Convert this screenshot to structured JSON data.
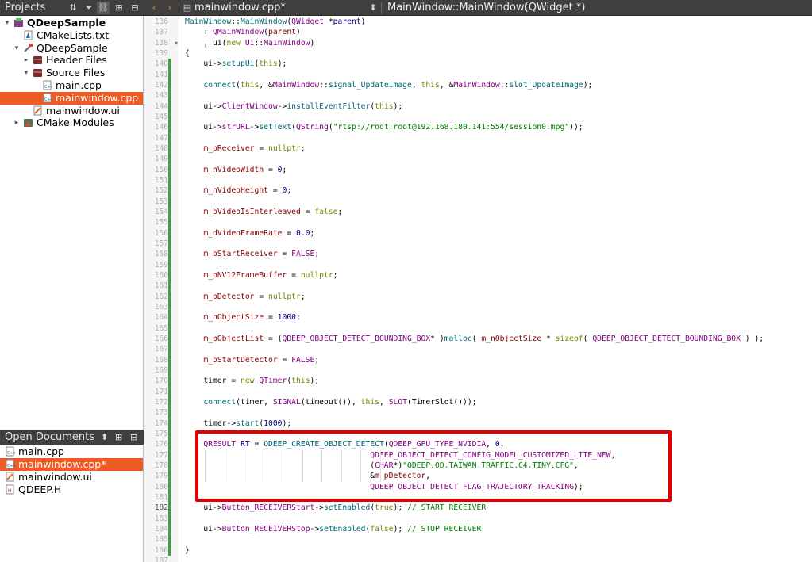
{
  "topbar": {
    "projects_label": "Projects",
    "open_file": "mainwindow.cpp*",
    "function": "MainWindow::MainWindow(QWidget *)"
  },
  "projects_tree": [
    {
      "label": "QDeepSample",
      "indent": 0,
      "arrow": "▾",
      "icon": "qt-project-icon",
      "bold": true,
      "selected": false
    },
    {
      "label": "CMakeLists.txt",
      "indent": 1,
      "arrow": "",
      "icon": "cmake-file-icon",
      "bold": false,
      "selected": false
    },
    {
      "label": "QDeepSample",
      "indent": 1,
      "arrow": "▾",
      "icon": "build-target-icon",
      "bold": false,
      "selected": false
    },
    {
      "label": "Header Files",
      "indent": 2,
      "arrow": "▸",
      "icon": "folder-icon",
      "bold": false,
      "selected": false
    },
    {
      "label": "Source Files",
      "indent": 2,
      "arrow": "▾",
      "icon": "folder-icon",
      "bold": false,
      "selected": false
    },
    {
      "label": "main.cpp",
      "indent": 3,
      "arrow": "",
      "icon": "cpp-file-icon",
      "bold": false,
      "selected": false
    },
    {
      "label": "mainwindow.cpp",
      "indent": 3,
      "arrow": "",
      "icon": "cpp-file-icon",
      "bold": false,
      "selected": true
    },
    {
      "label": "mainwindow.ui",
      "indent": 2,
      "arrow": "",
      "icon": "ui-file-icon",
      "bold": false,
      "selected": false
    },
    {
      "label": "CMake Modules",
      "indent": 1,
      "arrow": "▸",
      "icon": "cmake-folder-icon",
      "bold": false,
      "selected": false
    }
  ],
  "open_documents": {
    "label": "Open Documents",
    "items": [
      {
        "label": "main.cpp",
        "icon": "cpp-file-icon",
        "selected": false
      },
      {
        "label": "mainwindow.cpp*",
        "icon": "cpp-file-icon",
        "selected": true
      },
      {
        "label": "mainwindow.ui",
        "icon": "ui-file-icon",
        "selected": false
      },
      {
        "label": "QDEEP.H",
        "icon": "header-file-icon",
        "selected": false
      }
    ]
  },
  "editor": {
    "current_line": "182",
    "lines": [
      {
        "n": "136",
        "t": [
          [
            "f",
            "MainWindow"
          ],
          [
            "id",
            "::"
          ],
          [
            "f",
            "MainWindow"
          ],
          [
            "id",
            "("
          ],
          [
            "ty",
            "QWidget"
          ],
          [
            "id",
            " *"
          ],
          [
            "n",
            "parent"
          ],
          [
            "id",
            ")"
          ]
        ]
      },
      {
        "n": "137",
        "t": [
          [
            "id",
            "    : "
          ],
          [
            "ty",
            "QMainWindow"
          ],
          [
            "id",
            "("
          ],
          [
            "m",
            "parent"
          ],
          [
            "id",
            ")"
          ]
        ]
      },
      {
        "n": "138",
        "t": [
          [
            "id",
            "    , ui("
          ],
          [
            "k",
            "new"
          ],
          [
            "id",
            " "
          ],
          [
            "ty",
            "Ui"
          ],
          [
            "id",
            "::"
          ],
          [
            "ty",
            "MainWindow"
          ],
          [
            "id",
            ")"
          ]
        ]
      },
      {
        "n": "139",
        "t": [
          [
            "id",
            "{"
          ]
        ]
      },
      {
        "n": "140",
        "t": [
          [
            "id",
            "    ui->"
          ],
          [
            "f",
            "setupUi"
          ],
          [
            "id",
            "("
          ],
          [
            "k",
            "this"
          ],
          [
            "id",
            ");"
          ]
        ]
      },
      {
        "n": "141",
        "t": []
      },
      {
        "n": "142",
        "t": [
          [
            "id",
            "    "
          ],
          [
            "f",
            "connect"
          ],
          [
            "id",
            "("
          ],
          [
            "k",
            "this"
          ],
          [
            "id",
            ", &"
          ],
          [
            "ty",
            "MainWindow"
          ],
          [
            "id",
            "::"
          ],
          [
            "f",
            "signal_UpdateImage"
          ],
          [
            "id",
            ", "
          ],
          [
            "k",
            "this"
          ],
          [
            "id",
            ", &"
          ],
          [
            "ty",
            "MainWindow"
          ],
          [
            "id",
            "::"
          ],
          [
            "f",
            "slot_UpdateImage"
          ],
          [
            "id",
            ");"
          ]
        ]
      },
      {
        "n": "143",
        "t": []
      },
      {
        "n": "144",
        "t": [
          [
            "id",
            "    ui->"
          ],
          [
            "ty",
            "ClientWindow"
          ],
          [
            "id",
            "->"
          ],
          [
            "f",
            "installEventFilter"
          ],
          [
            "id",
            "("
          ],
          [
            "k",
            "this"
          ],
          [
            "id",
            ");"
          ]
        ]
      },
      {
        "n": "145",
        "t": []
      },
      {
        "n": "146",
        "t": [
          [
            "id",
            "    ui->"
          ],
          [
            "ty",
            "strURL"
          ],
          [
            "id",
            "->"
          ],
          [
            "f",
            "setText"
          ],
          [
            "id",
            "("
          ],
          [
            "ty",
            "QString"
          ],
          [
            "id",
            "("
          ],
          [
            "s",
            "\"rtsp://root:root@192.168.180.141:554/session0.mpg\""
          ],
          [
            "id",
            "));"
          ]
        ]
      },
      {
        "n": "147",
        "t": []
      },
      {
        "n": "148",
        "t": [
          [
            "id",
            "    "
          ],
          [
            "m",
            "m_pReceiver"
          ],
          [
            "id",
            " = "
          ],
          [
            "k",
            "nullptr"
          ],
          [
            "id",
            ";"
          ]
        ]
      },
      {
        "n": "149",
        "t": []
      },
      {
        "n": "150",
        "t": [
          [
            "id",
            "    "
          ],
          [
            "m",
            "m_nVideoWidth"
          ],
          [
            "id",
            " = "
          ],
          [
            "n",
            "0"
          ],
          [
            "id",
            ";"
          ]
        ]
      },
      {
        "n": "151",
        "t": []
      },
      {
        "n": "152",
        "t": [
          [
            "id",
            "    "
          ],
          [
            "m",
            "m_nVideoHeight"
          ],
          [
            "id",
            " = "
          ],
          [
            "n",
            "0"
          ],
          [
            "id",
            ";"
          ]
        ]
      },
      {
        "n": "153",
        "t": []
      },
      {
        "n": "154",
        "t": [
          [
            "id",
            "    "
          ],
          [
            "m",
            "m_bVideoIsInterleaved"
          ],
          [
            "id",
            " = "
          ],
          [
            "k",
            "false"
          ],
          [
            "id",
            ";"
          ]
        ]
      },
      {
        "n": "155",
        "t": []
      },
      {
        "n": "156",
        "t": [
          [
            "id",
            "    "
          ],
          [
            "m",
            "m_dVideoFrameRate"
          ],
          [
            "id",
            " = "
          ],
          [
            "n",
            "0.0"
          ],
          [
            "id",
            ";"
          ]
        ]
      },
      {
        "n": "157",
        "t": []
      },
      {
        "n": "158",
        "t": [
          [
            "id",
            "    "
          ],
          [
            "m",
            "m_bStartReceiver"
          ],
          [
            "id",
            " = "
          ],
          [
            "ty",
            "FALSE"
          ],
          [
            "id",
            ";"
          ]
        ]
      },
      {
        "n": "159",
        "t": []
      },
      {
        "n": "160",
        "t": [
          [
            "id",
            "    "
          ],
          [
            "m",
            "m_pNV12FrameBuffer"
          ],
          [
            "id",
            " = "
          ],
          [
            "k",
            "nullptr"
          ],
          [
            "id",
            ";"
          ]
        ]
      },
      {
        "n": "161",
        "t": []
      },
      {
        "n": "162",
        "t": [
          [
            "id",
            "    "
          ],
          [
            "m",
            "m_pDetector"
          ],
          [
            "id",
            " = "
          ],
          [
            "k",
            "nullptr"
          ],
          [
            "id",
            ";"
          ]
        ]
      },
      {
        "n": "163",
        "t": []
      },
      {
        "n": "164",
        "t": [
          [
            "id",
            "    "
          ],
          [
            "m",
            "m_nObjectSize"
          ],
          [
            "id",
            " = "
          ],
          [
            "n",
            "1000"
          ],
          [
            "id",
            ";"
          ]
        ]
      },
      {
        "n": "165",
        "t": []
      },
      {
        "n": "166",
        "t": [
          [
            "id",
            "    "
          ],
          [
            "m",
            "m_pObjectList"
          ],
          [
            "id",
            " = ("
          ],
          [
            "ty",
            "QDEEP_OBJECT_DETECT_BOUNDING_BOX"
          ],
          [
            "id",
            "* )"
          ],
          [
            "f",
            "malloc"
          ],
          [
            "id",
            "( "
          ],
          [
            "m",
            "m_nObjectSize"
          ],
          [
            "id",
            " * "
          ],
          [
            "k",
            "sizeof"
          ],
          [
            "id",
            "( "
          ],
          [
            "ty",
            "QDEEP_OBJECT_DETECT_BOUNDING_BOX"
          ],
          [
            "id",
            " ) );"
          ]
        ]
      },
      {
        "n": "167",
        "t": []
      },
      {
        "n": "168",
        "t": [
          [
            "id",
            "    "
          ],
          [
            "m",
            "m_bStartDetector"
          ],
          [
            "id",
            " = "
          ],
          [
            "ty",
            "FALSE"
          ],
          [
            "id",
            ";"
          ]
        ]
      },
      {
        "n": "169",
        "t": []
      },
      {
        "n": "170",
        "t": [
          [
            "id",
            "    timer = "
          ],
          [
            "k",
            "new"
          ],
          [
            "id",
            " "
          ],
          [
            "ty",
            "QTimer"
          ],
          [
            "id",
            "("
          ],
          [
            "k",
            "this"
          ],
          [
            "id",
            ");"
          ]
        ]
      },
      {
        "n": "171",
        "t": []
      },
      {
        "n": "172",
        "t": [
          [
            "id",
            "    "
          ],
          [
            "f",
            "connect"
          ],
          [
            "id",
            "(timer, "
          ],
          [
            "ty",
            "SIGNAL"
          ],
          [
            "id",
            "(timeout()), "
          ],
          [
            "k",
            "this"
          ],
          [
            "id",
            ", "
          ],
          [
            "ty",
            "SLOT"
          ],
          [
            "id",
            "(TimerSlot()));"
          ]
        ]
      },
      {
        "n": "173",
        "t": []
      },
      {
        "n": "174",
        "t": [
          [
            "id",
            "    timer->"
          ],
          [
            "f",
            "start"
          ],
          [
            "id",
            "("
          ],
          [
            "n",
            "1000"
          ],
          [
            "id",
            ");"
          ]
        ]
      },
      {
        "n": "175",
        "t": []
      },
      {
        "n": "176",
        "t": [
          [
            "id",
            "    "
          ],
          [
            "ty",
            "QRESULT"
          ],
          [
            "id",
            " "
          ],
          [
            "n",
            "RT"
          ],
          [
            "id",
            " = "
          ],
          [
            "f",
            "QDEEP_CREATE_OBJECT_DETECT"
          ],
          [
            "id",
            "("
          ],
          [
            "ty",
            "QDEEP_GPU_TYPE_NVIDIA"
          ],
          [
            "id",
            ", "
          ],
          [
            "n",
            "0"
          ],
          [
            "id",
            ","
          ]
        ]
      },
      {
        "n": "177",
        "t": [
          [
            "id",
            "                                        "
          ],
          [
            "ty",
            "QDEEP_OBJECT_DETECT_CONFIG_MODEL_CUSTOMIZED_LITE_NEW"
          ],
          [
            "id",
            ","
          ]
        ]
      },
      {
        "n": "178",
        "t": [
          [
            "id",
            "                                        ("
          ],
          [
            "ty",
            "CHAR"
          ],
          [
            "id",
            "*)"
          ],
          [
            "s",
            "\"QDEEP.OD.TAIWAN.TRAFFIC.C4.TINY.CFG\""
          ],
          [
            "id",
            ","
          ]
        ]
      },
      {
        "n": "179",
        "t": [
          [
            "id",
            "                                        &"
          ],
          [
            "m",
            "m_pDetector"
          ],
          [
            "id",
            ","
          ]
        ]
      },
      {
        "n": "180",
        "t": [
          [
            "id",
            "                                        "
          ],
          [
            "ty",
            "QDEEP_OBJECT_DETECT_FLAG_TRAJECTORY_TRACKING"
          ],
          [
            "id",
            ");"
          ]
        ]
      },
      {
        "n": "181",
        "t": []
      },
      {
        "n": "182",
        "t": [
          [
            "id",
            "    ui->"
          ],
          [
            "ty",
            "Button_RECEIVERStart"
          ],
          [
            "id",
            "->"
          ],
          [
            "f",
            "setEnabled"
          ],
          [
            "id",
            "("
          ],
          [
            "k",
            "true"
          ],
          [
            "id",
            "); "
          ],
          [
            "c",
            "// START RECEIVER"
          ]
        ]
      },
      {
        "n": "183",
        "t": []
      },
      {
        "n": "184",
        "t": [
          [
            "id",
            "    ui->"
          ],
          [
            "ty",
            "Button_RECEIVERStop"
          ],
          [
            "id",
            "->"
          ],
          [
            "f",
            "setEnabled"
          ],
          [
            "id",
            "("
          ],
          [
            "k",
            "false"
          ],
          [
            "id",
            "); "
          ],
          [
            "c",
            "// STOP RECEIVER"
          ]
        ]
      },
      {
        "n": "185",
        "t": []
      },
      {
        "n": "186",
        "t": [
          [
            "id",
            "}"
          ]
        ]
      },
      {
        "n": "187",
        "t": []
      }
    ]
  }
}
